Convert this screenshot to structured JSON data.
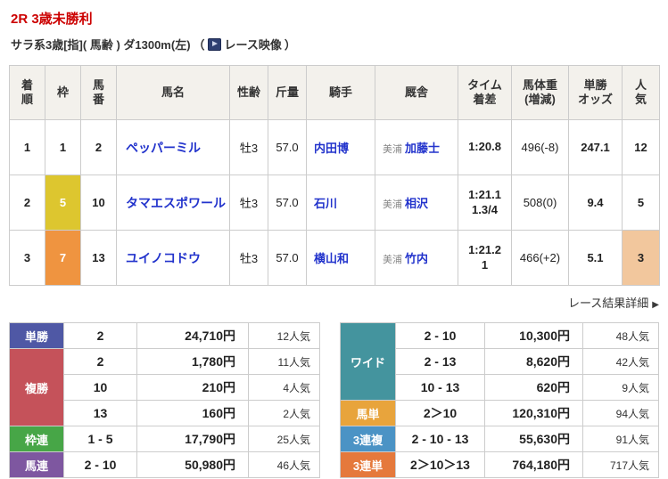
{
  "colors": {
    "title_red": "#cc0000",
    "link_blue": "#2233cc",
    "table_header_bg": "#f3f1ec",
    "table_border": "#cccccc",
    "frame_1_bg": "#ffffff",
    "frame_5_bg": "#ddc62f",
    "frame_7_bg": "#ef9440",
    "popularity_highlight_bg": "#f2c79d",
    "tansho_label_bg": "#4f58a5",
    "fukusho_label_bg": "#c5525a",
    "wakuren_label_bg": "#47a647",
    "umaren_label_bg": "#7e57a0",
    "wide_label_bg": "#44949e",
    "umatan_label_bg": "#e8a43c",
    "sanrenpuku_label_bg": "#4b93c5",
    "sanrentan_label_bg": "#e5793c"
  },
  "header": {
    "race_title": "2R 3歳未勝利",
    "race_conditions": "サラ系3歳[指]( 馬齢 ) ダ1300m(左)",
    "video_paren_open": "（",
    "video_icon": "video-play-icon",
    "video_label": "レース映像",
    "video_paren_close": "）"
  },
  "results_table": {
    "headers": {
      "pos": "着\n順",
      "frame": "枠",
      "num": "馬\n番",
      "name": "馬名",
      "sex_age": "性齢",
      "weight": "斤量",
      "jockey": "騎手",
      "stable": "厩舎",
      "time": "タイム\n着差",
      "body_weight": "馬体重\n(増減)",
      "odds": "単勝\nオッズ",
      "pop": "人\n気"
    },
    "rows": [
      {
        "pos": "1",
        "frame": "1",
        "frame_style": "",
        "num": "2",
        "name": "ペッパーミル",
        "sex_age": "牡3",
        "weight": "57.0",
        "jockey": "内田博",
        "region": "美浦",
        "trainer": "加藤士",
        "time": "1:20.8",
        "body_weight": "496(-8)",
        "odds": "247.1",
        "pop": "12",
        "pop_style": ""
      },
      {
        "pos": "2",
        "frame": "5",
        "frame_style": "background:#ddc62f;color:#ffffff;",
        "num": "10",
        "name": "タマエスポワール",
        "sex_age": "牡3",
        "weight": "57.0",
        "jockey": "石川",
        "region": "美浦",
        "trainer": "相沢",
        "time": "1:21.1\n1.3/4",
        "body_weight": "508(0)",
        "odds": "9.4",
        "pop": "5",
        "pop_style": ""
      },
      {
        "pos": "3",
        "frame": "7",
        "frame_style": "background:#ef9440;color:#ffffff;",
        "num": "13",
        "name": "ユイノコドウ",
        "sex_age": "牡3",
        "weight": "57.0",
        "jockey": "横山和",
        "region": "美浦",
        "trainer": "竹内",
        "time": "1:21.2\n1",
        "body_weight": "466(+2)",
        "odds": "5.1",
        "pop": "3",
        "pop_style": "background:#f2c79d;"
      }
    ]
  },
  "detail_link": {
    "label": "レース結果詳細",
    "arrow": "▶"
  },
  "payouts": {
    "left": [
      {
        "label": "単勝",
        "label_style": "background:#4f58a5;",
        "rows": [
          {
            "combo": "2",
            "amount": "24,710円",
            "pop": "12人気"
          }
        ]
      },
      {
        "label": "複勝",
        "label_style": "background:#c5525a;",
        "rows": [
          {
            "combo": "2",
            "amount": "1,780円",
            "pop": "11人気"
          },
          {
            "combo": "10",
            "amount": "210円",
            "pop": "4人気"
          },
          {
            "combo": "13",
            "amount": "160円",
            "pop": "2人気"
          }
        ]
      },
      {
        "label": "枠連",
        "label_style": "background:#47a647;",
        "rows": [
          {
            "combo": "1 - 5",
            "amount": "17,790円",
            "pop": "25人気"
          }
        ]
      },
      {
        "label": "馬連",
        "label_style": "background:#7e57a0;",
        "rows": [
          {
            "combo": "2 - 10",
            "amount": "50,980円",
            "pop": "46人気"
          }
        ]
      }
    ],
    "right": [
      {
        "label": "ワイド",
        "label_style": "background:#44949e;",
        "rows": [
          {
            "combo": "2 - 10",
            "amount": "10,300円",
            "pop": "48人気"
          },
          {
            "combo": "2 - 13",
            "amount": "8,620円",
            "pop": "42人気"
          },
          {
            "combo": "10 - 13",
            "amount": "620円",
            "pop": "9人気"
          }
        ]
      },
      {
        "label": "馬単",
        "label_style": "background:#e8a43c;",
        "rows": [
          {
            "combo": "2＞10",
            "amount": "120,310円",
            "pop": "94人気"
          }
        ]
      },
      {
        "label": "3連複",
        "label_style": "background:#4b93c5;",
        "rows": [
          {
            "combo": "2 - 10 - 13",
            "amount": "55,630円",
            "pop": "91人気"
          }
        ]
      },
      {
        "label": "3連単",
        "label_style": "background:#e5793c;",
        "rows": [
          {
            "combo": "2＞10＞13",
            "amount": "764,180円",
            "pop": "717人気"
          }
        ]
      }
    ]
  }
}
